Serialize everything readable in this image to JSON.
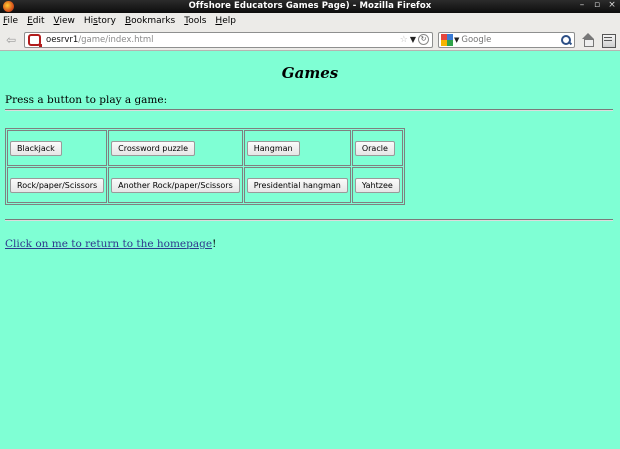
{
  "window": {
    "title": "Offshore Educators Games Page) - Mozilla Firefox",
    "controls": [
      "–",
      "▫",
      "×"
    ]
  },
  "menu": {
    "items": [
      {
        "ul": "F",
        "rest": "ile"
      },
      {
        "ul": "E",
        "rest": "dit"
      },
      {
        "ul": "V",
        "rest": "iew"
      },
      {
        "ul": "H",
        "rest": "istory",
        "pre": "Hi",
        "mid": "s",
        "post": "tory"
      },
      {
        "ul": "B",
        "rest": "ookmarks"
      },
      {
        "ul": "T",
        "rest": "ools"
      },
      {
        "ul": "H",
        "rest": "elp"
      }
    ]
  },
  "nav": {
    "url_host": "oesrvr1",
    "url_path": "/game/index.html",
    "search_placeholder": "Google",
    "search_engine_colors": [
      "#e6473d",
      "#3a7bd5",
      "#f5b400",
      "#2fa34a"
    ]
  },
  "page": {
    "title": "Games",
    "intro": "Press a button to play a game:",
    "games": [
      [
        "Blackjack",
        "Crossword puzzle",
        "Hangman",
        "Oracle"
      ],
      [
        "Rock/paper/Scissors",
        "Another Rock/paper/Scissors",
        "Presidential hangman",
        "Yahtzee"
      ]
    ],
    "home_link": "Click on me to return to the homepage",
    "home_link_suffix": "!"
  }
}
